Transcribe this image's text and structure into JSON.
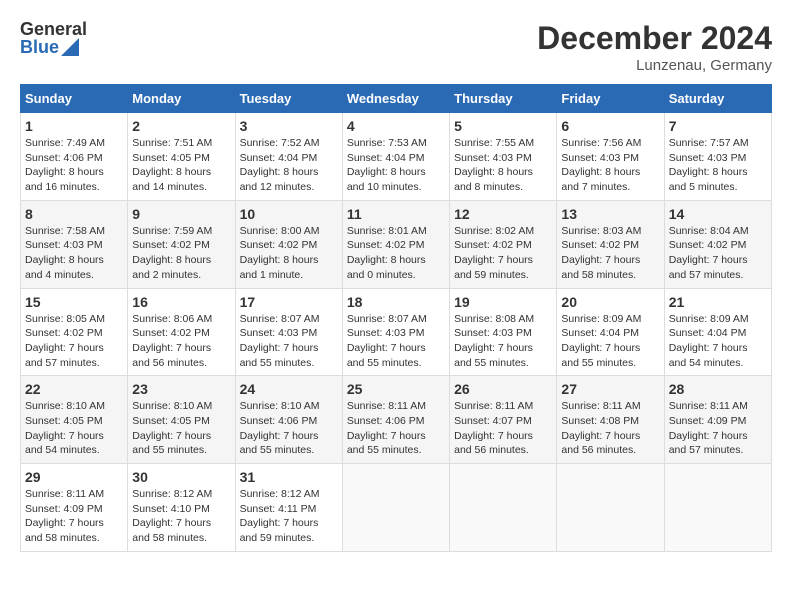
{
  "header": {
    "logo_general": "General",
    "logo_blue": "Blue",
    "title": "December 2024",
    "subtitle": "Lunzenau, Germany"
  },
  "columns": [
    "Sunday",
    "Monday",
    "Tuesday",
    "Wednesday",
    "Thursday",
    "Friday",
    "Saturday"
  ],
  "weeks": [
    [
      {
        "day": "1",
        "sunrise": "7:49 AM",
        "sunset": "4:06 PM",
        "daylight": "8 hours and 16 minutes."
      },
      {
        "day": "2",
        "sunrise": "7:51 AM",
        "sunset": "4:05 PM",
        "daylight": "8 hours and 14 minutes."
      },
      {
        "day": "3",
        "sunrise": "7:52 AM",
        "sunset": "4:04 PM",
        "daylight": "8 hours and 12 minutes."
      },
      {
        "day": "4",
        "sunrise": "7:53 AM",
        "sunset": "4:04 PM",
        "daylight": "8 hours and 10 minutes."
      },
      {
        "day": "5",
        "sunrise": "7:55 AM",
        "sunset": "4:03 PM",
        "daylight": "8 hours and 8 minutes."
      },
      {
        "day": "6",
        "sunrise": "7:56 AM",
        "sunset": "4:03 PM",
        "daylight": "8 hours and 7 minutes."
      },
      {
        "day": "7",
        "sunrise": "7:57 AM",
        "sunset": "4:03 PM",
        "daylight": "8 hours and 5 minutes."
      }
    ],
    [
      {
        "day": "8",
        "sunrise": "7:58 AM",
        "sunset": "4:03 PM",
        "daylight": "8 hours and 4 minutes."
      },
      {
        "day": "9",
        "sunrise": "7:59 AM",
        "sunset": "4:02 PM",
        "daylight": "8 hours and 2 minutes."
      },
      {
        "day": "10",
        "sunrise": "8:00 AM",
        "sunset": "4:02 PM",
        "daylight": "8 hours and 1 minute."
      },
      {
        "day": "11",
        "sunrise": "8:01 AM",
        "sunset": "4:02 PM",
        "daylight": "8 hours and 0 minutes."
      },
      {
        "day": "12",
        "sunrise": "8:02 AM",
        "sunset": "4:02 PM",
        "daylight": "7 hours and 59 minutes."
      },
      {
        "day": "13",
        "sunrise": "8:03 AM",
        "sunset": "4:02 PM",
        "daylight": "7 hours and 58 minutes."
      },
      {
        "day": "14",
        "sunrise": "8:04 AM",
        "sunset": "4:02 PM",
        "daylight": "7 hours and 57 minutes."
      }
    ],
    [
      {
        "day": "15",
        "sunrise": "8:05 AM",
        "sunset": "4:02 PM",
        "daylight": "7 hours and 57 minutes."
      },
      {
        "day": "16",
        "sunrise": "8:06 AM",
        "sunset": "4:02 PM",
        "daylight": "7 hours and 56 minutes."
      },
      {
        "day": "17",
        "sunrise": "8:07 AM",
        "sunset": "4:03 PM",
        "daylight": "7 hours and 55 minutes."
      },
      {
        "day": "18",
        "sunrise": "8:07 AM",
        "sunset": "4:03 PM",
        "daylight": "7 hours and 55 minutes."
      },
      {
        "day": "19",
        "sunrise": "8:08 AM",
        "sunset": "4:03 PM",
        "daylight": "7 hours and 55 minutes."
      },
      {
        "day": "20",
        "sunrise": "8:09 AM",
        "sunset": "4:04 PM",
        "daylight": "7 hours and 55 minutes."
      },
      {
        "day": "21",
        "sunrise": "8:09 AM",
        "sunset": "4:04 PM",
        "daylight": "7 hours and 54 minutes."
      }
    ],
    [
      {
        "day": "22",
        "sunrise": "8:10 AM",
        "sunset": "4:05 PM",
        "daylight": "7 hours and 54 minutes."
      },
      {
        "day": "23",
        "sunrise": "8:10 AM",
        "sunset": "4:05 PM",
        "daylight": "7 hours and 55 minutes."
      },
      {
        "day": "24",
        "sunrise": "8:10 AM",
        "sunset": "4:06 PM",
        "daylight": "7 hours and 55 minutes."
      },
      {
        "day": "25",
        "sunrise": "8:11 AM",
        "sunset": "4:06 PM",
        "daylight": "7 hours and 55 minutes."
      },
      {
        "day": "26",
        "sunrise": "8:11 AM",
        "sunset": "4:07 PM",
        "daylight": "7 hours and 56 minutes."
      },
      {
        "day": "27",
        "sunrise": "8:11 AM",
        "sunset": "4:08 PM",
        "daylight": "7 hours and 56 minutes."
      },
      {
        "day": "28",
        "sunrise": "8:11 AM",
        "sunset": "4:09 PM",
        "daylight": "7 hours and 57 minutes."
      }
    ],
    [
      {
        "day": "29",
        "sunrise": "8:11 AM",
        "sunset": "4:09 PM",
        "daylight": "7 hours and 58 minutes."
      },
      {
        "day": "30",
        "sunrise": "8:12 AM",
        "sunset": "4:10 PM",
        "daylight": "7 hours and 58 minutes."
      },
      {
        "day": "31",
        "sunrise": "8:12 AM",
        "sunset": "4:11 PM",
        "daylight": "7 hours and 59 minutes."
      },
      null,
      null,
      null,
      null
    ]
  ]
}
